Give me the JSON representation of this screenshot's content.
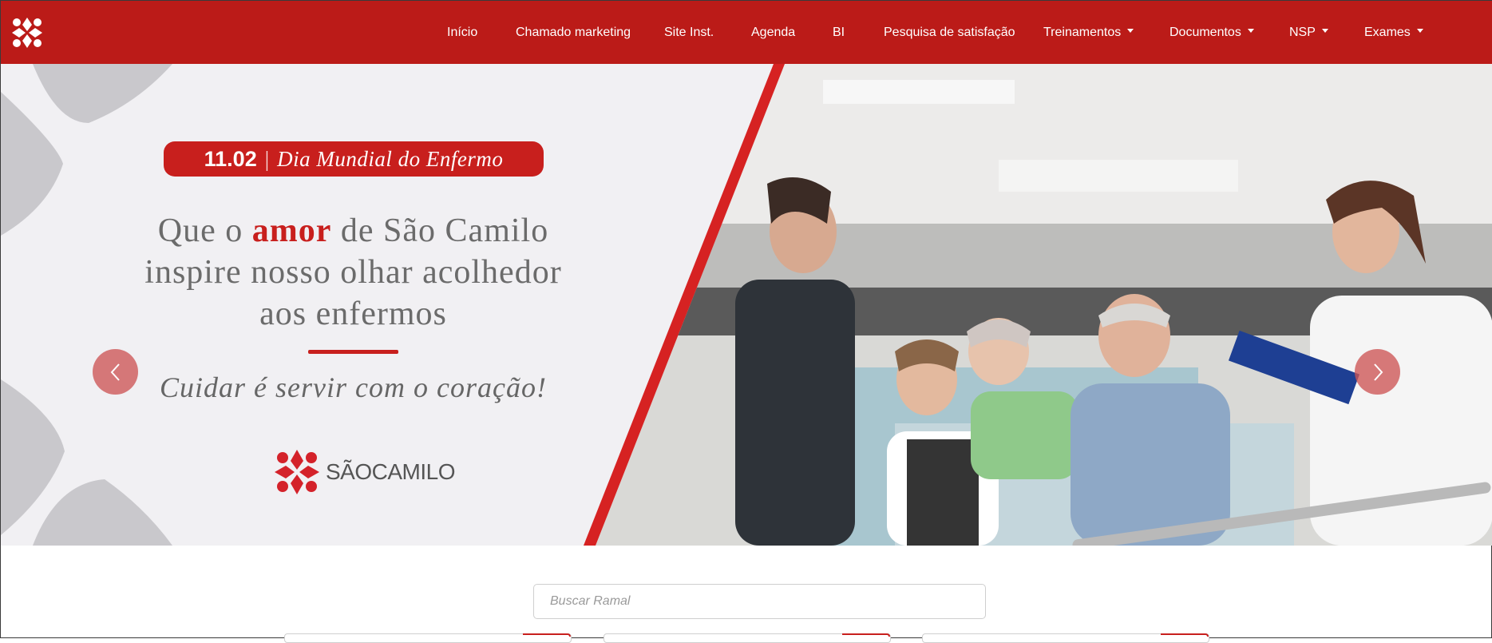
{
  "nav": {
    "items": [
      {
        "label": "Início",
        "dropdown": false
      },
      {
        "label": "Chamado marketing",
        "dropdown": false
      },
      {
        "label": "Site Inst.",
        "dropdown": false
      },
      {
        "label": "Agenda",
        "dropdown": false
      },
      {
        "label": "BI",
        "dropdown": false
      },
      {
        "label": "Pesquisa de satisfação",
        "dropdown": false
      },
      {
        "label": "Treinamentos",
        "dropdown": true
      },
      {
        "label": "Documentos",
        "dropdown": true
      },
      {
        "label": "NSP",
        "dropdown": true
      },
      {
        "label": "Exames",
        "dropdown": true
      }
    ]
  },
  "hero": {
    "badge_date": "11.02",
    "badge_separator": "|",
    "badge_event": "Dia Mundial do Enfermo",
    "headline_prefix": "Que o ",
    "headline_highlight": "amor",
    "headline_suffix_1": " de São Camilo",
    "headline_line_2": "inspire nosso olhar acolhedor",
    "headline_line_3": "aos enfermos",
    "tagline": "Cuidar é servir com o coração!",
    "logo_sao": "SÃO",
    "logo_camilo": "CAMILO",
    "prev_icon": "chevron-left-icon",
    "next_icon": "chevron-right-icon"
  },
  "search": {
    "placeholder": "Buscar Ramal",
    "value": ""
  },
  "colors": {
    "brand_red": "#bb1b18",
    "accent_red": "#c81f1d",
    "hero_bg": "#f1f0f3"
  }
}
